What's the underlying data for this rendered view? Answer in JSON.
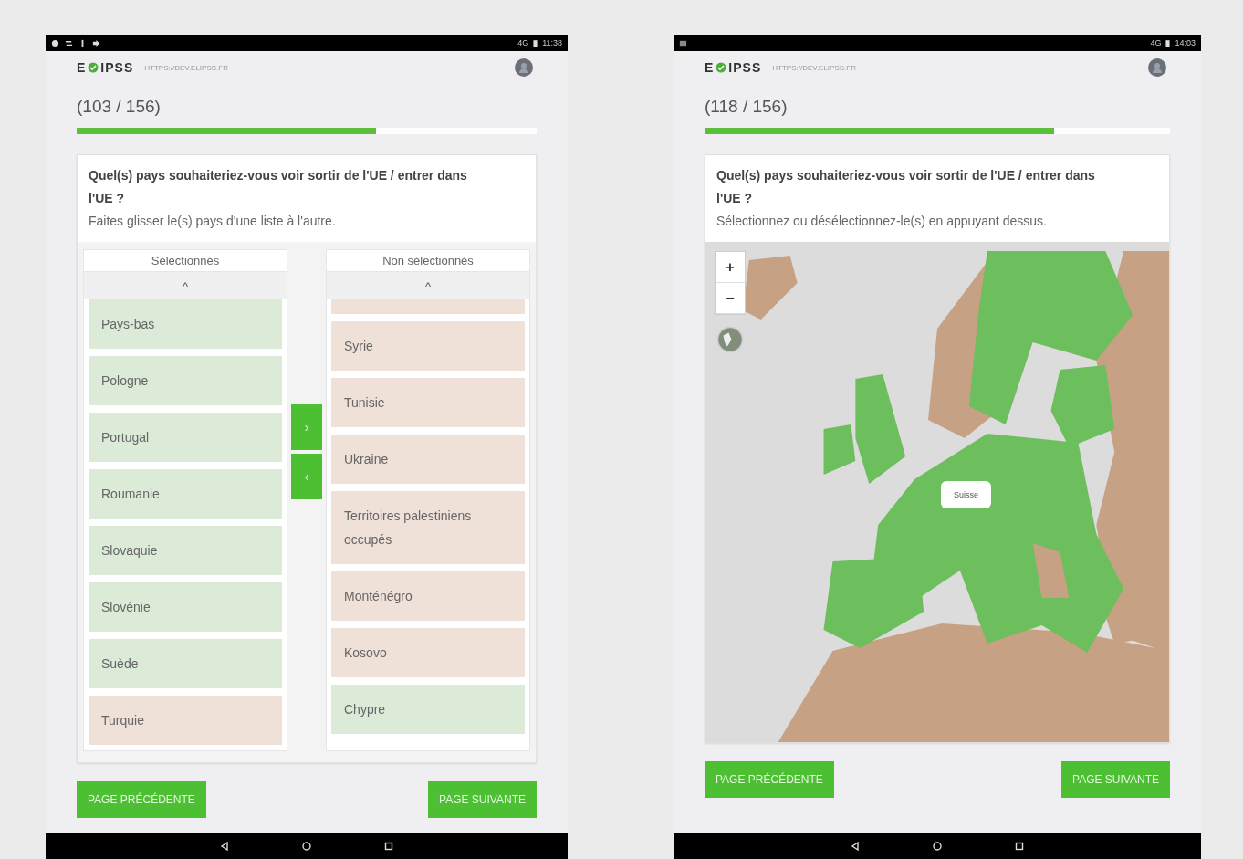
{
  "screens": [
    {
      "kind": "lists",
      "status_bar": {
        "icons": [
          {
            "kind": "shield"
          },
          {
            "kind": "sync"
          },
          {
            "kind": "social"
          },
          {
            "kind": "arrow"
          }
        ],
        "network": "4G",
        "time": "11:38"
      },
      "logo": {
        "left": "E",
        "right": "IPSS"
      },
      "url": "HTTPS://DEV.ELIPSS.FR",
      "counter": "(103 / 156)",
      "progress": {
        "level": 0.65
      },
      "question": "Quel(s) pays souhaiteriez-vous voir sortir de l'UE / entrer dans l'UE ?",
      "instruction": "Faites glisser le(s) pays d'une liste à l'autre.",
      "lists": [
        {
          "title": "Sélectionnés",
          "scroll": "^",
          "items": [
            {
              "name": "Pays-bas",
              "color": "#dcebd8"
            },
            {
              "name": "Pologne",
              "color": "#dcebd8"
            },
            {
              "name": "Portugal",
              "color": "#dcebd8"
            },
            {
              "name": "Roumanie",
              "color": "#dcebd8"
            },
            {
              "name": "Slovaquie",
              "color": "#dcebd8"
            },
            {
              "name": "Slovénie",
              "color": "#dcebd8"
            },
            {
              "name": "Suède",
              "color": "#dcebd8"
            },
            {
              "name": "Turquie",
              "color": "#efe0d8"
            }
          ]
        },
        {
          "title": "Non sélectionnés",
          "scroll": "^",
          "items": [
            {
              "cut": true,
              "color": "#efe0d8"
            },
            {
              "name": "Syrie",
              "color": "#efe0d8"
            },
            {
              "name": "Tunisie",
              "color": "#efe0d8"
            },
            {
              "name": "Ukraine",
              "color": "#efe0d8"
            },
            {
              "name": "Territoires palestiniens occupés",
              "color": "#efe0d8"
            },
            {
              "name": "Monténégro",
              "color": "#efe0d8"
            },
            {
              "name": "Kosovo",
              "color": "#efe0d8"
            },
            {
              "name": "Chypre",
              "color": "#dcebd8"
            }
          ]
        }
      ],
      "move_buttons": [
        "›",
        "‹"
      ],
      "buttons": [
        "PAGE PRÉCÉDENTE",
        "PAGE SUIVANTE"
      ]
    },
    {
      "kind": "map",
      "status_bar": {
        "icons": [
          {
            "kind": "menu"
          }
        ],
        "network": "4G",
        "time": "14:03"
      },
      "logo": {
        "left": "E",
        "right": "IPSS"
      },
      "url": "HTTPS://DEV.ELIPSS.FR",
      "counter": "(118 / 156)",
      "progress": {
        "level": 0.75
      },
      "question": "Quel(s) pays souhaiteriez-vous voir sortir de l'UE / entrer dans l'UE ?",
      "instruction": "Sélectionnez ou désélectionnez-le(s) en appuyant dessus.",
      "map": {
        "zoom_in": "+",
        "zoom_out": "−",
        "tooltip": "Suisse"
      },
      "buttons": [
        "PAGE PRÉCÉDENTE",
        "PAGE SUIVANTE"
      ]
    }
  ]
}
